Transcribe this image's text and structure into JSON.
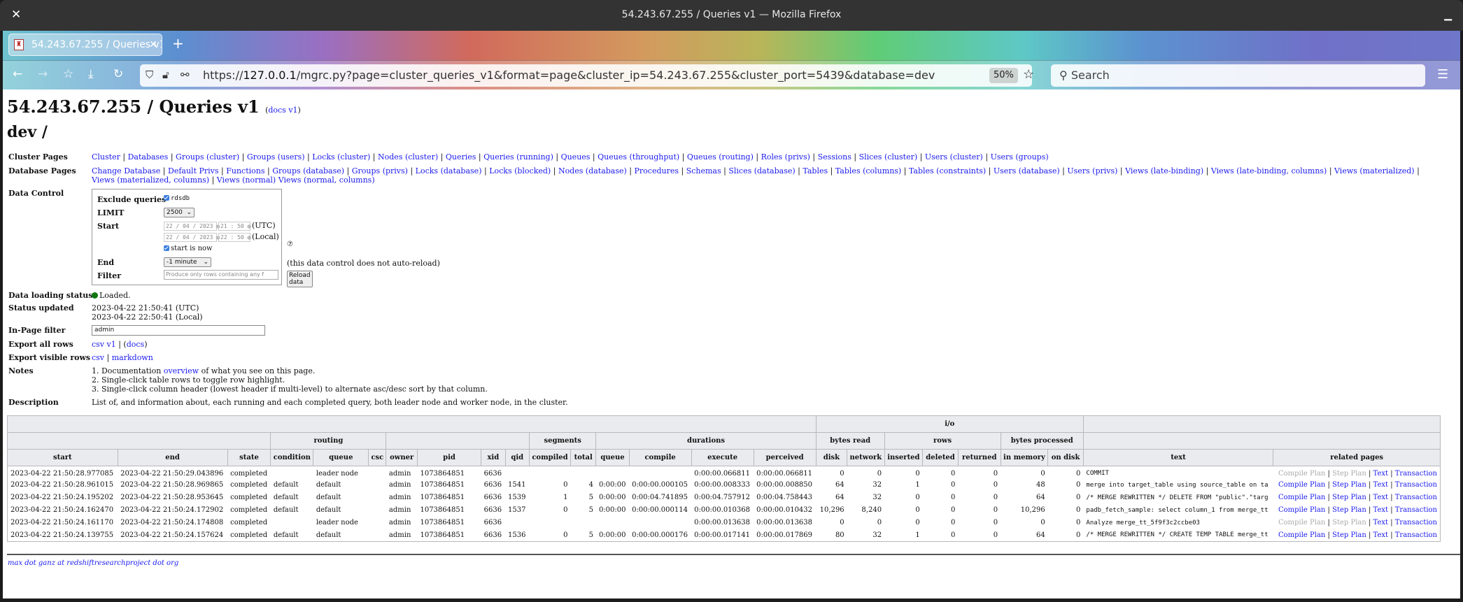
{
  "window": {
    "title": "54.243.67.255 / Queries v1 — Mozilla Firefox",
    "close_icon": "close-icon",
    "minimize_icon": "minimize-icon"
  },
  "browser": {
    "tab_title": "54.243.67.255 / Queries v1",
    "url_prefix": "https://",
    "url_host": "127.0.0.1",
    "url_rest": "/mgrc.py?page=cluster_queries_v1&format=page&cluster_ip=54.243.67.255&cluster_port=5439&database=dev",
    "zoom": "50%",
    "search_placeholder": "Search"
  },
  "page": {
    "title": "54.243.67.255 / Queries v1",
    "docs_link": "docs v1",
    "subtitle": "dev /",
    "cluster_pages_label": "Cluster Pages",
    "cluster_pages": [
      "Cluster",
      "Databases",
      "Groups (cluster)",
      "Groups (users)",
      "Locks (cluster)",
      "Nodes (cluster)",
      "Queries",
      "Queries (running)",
      "Queues",
      "Queues (throughput)",
      "Queues (routing)",
      "Roles (privs)",
      "Sessions",
      "Slices (cluster)",
      "Users (cluster)",
      "Users (groups)"
    ],
    "database_pages_label": "Database Pages",
    "database_pages": [
      "Change Database",
      "Default Privs",
      "Functions",
      "Groups (database)",
      "Groups (privs)",
      "Locks (database)",
      "Locks (blocked)",
      "Nodes (database)",
      "Procedures",
      "Schemas",
      "Slices (database)",
      "Tables",
      "Tables (columns)",
      "Tables (constraints)",
      "Users (database)",
      "Users (privs)",
      "Views (late-binding)",
      "Views (late-binding, columns)",
      "Views (materialized)",
      "Views (materialized, columns)",
      "Views (normal)",
      "Views (normal, columns)"
    ],
    "data_control": {
      "label": "Data Control",
      "exclude_label": "Exclude queries",
      "exclude_value": "rdsdb",
      "exclude_checked": true,
      "limit_label": "LIMIT",
      "limit_value": "2500",
      "start_label": "Start",
      "start_utc_date": "22 / 04 / 2023",
      "start_utc_time": "21 : 50",
      "utc_suffix": "(UTC)",
      "start_local_date": "22 / 04 / 2023",
      "start_local_time": "22 : 50",
      "local_suffix": "(Local)",
      "start_is_now_label": "start is now",
      "start_is_now_checked": true,
      "end_label": "End",
      "end_value": "-1 minute",
      "filter_label": "Filter",
      "filter_placeholder": "Produce only rows containing any f",
      "help_icon": "?",
      "no_reload_note": "(this data control does not auto-reload)",
      "reload_button": "Reload data"
    },
    "loading_status_label": "Data loading status",
    "loading_status": "Loaded.",
    "status_color": "#117711",
    "status_updated_label": "Status updated",
    "status_updated_utc": "2023-04-22 21:50:41 (UTC)",
    "status_updated_local": "2023-04-22 22:50:41 (Local)",
    "inpage_filter_label": "In-Page filter",
    "inpage_filter_value": "admin",
    "export_all_label": "Export all rows",
    "export_all_csv": "csv v1",
    "export_all_docs": "docs",
    "export_visible_label": "Export visible rows",
    "export_visible_csv": "csv",
    "export_visible_markdown": "markdown",
    "notes_label": "Notes",
    "notes_1_pre": "1. Documentation ",
    "notes_1_link": "overview",
    "notes_1_post": " of what you see on this page.",
    "notes_2": "2. Single-click table rows to toggle row highlight.",
    "notes_3": "3. Single-click column header (lowest header if multi-level) to alternate asc/desc sort by that column.",
    "description_label": "Description",
    "description": "List of, and information about, each running and each completed query, both leader node and worker node, in the cluster.",
    "footer": "max dot ganz at redshiftresearchproject dot org"
  },
  "table": {
    "group_top": {
      "io": "i/o"
    },
    "group_mid": {
      "routing": "routing",
      "segments": "segments",
      "durations": "durations",
      "bytes_read": "bytes read",
      "rows": "rows",
      "bytes_processed": "bytes processed"
    },
    "columns": [
      "start",
      "end",
      "state",
      "condition",
      "queue",
      "csc",
      "owner",
      "pid",
      "xid",
      "qid",
      "compiled",
      "total",
      "queue",
      "compile",
      "execute",
      "perceived",
      "disk",
      "network",
      "inserted",
      "deleted",
      "returned",
      "in memory",
      "on disk",
      "text",
      "related pages"
    ],
    "related_labels": {
      "compile_plan": "Compile Plan",
      "step_plan": "Step Plan",
      "text": "Text",
      "transaction": "Transaction"
    },
    "rows": [
      {
        "start": "2023-04-22 21:50:28.977085",
        "end": "2023-04-22 21:50:29.043896",
        "state": "completed",
        "condition": "",
        "queue": "leader node",
        "csc": "",
        "owner": "admin",
        "pid": "1073864851",
        "xid": "6636",
        "qid": "",
        "compiled": "",
        "total": "",
        "dqueue": "",
        "compile": "",
        "execute": "0:00:00.066811",
        "perceived": "0:00:00.066811",
        "disk": "0",
        "network": "0",
        "inserted": "0",
        "deleted": "0",
        "returned": "0",
        "in_memory": "0",
        "on_disk": "0",
        "text": "COMMIT",
        "plans_enabled": false
      },
      {
        "start": "2023-04-22 21:50:28.961015",
        "end": "2023-04-22 21:50:28.969865",
        "state": "completed",
        "condition": "default",
        "queue": "default",
        "csc": "",
        "owner": "admin",
        "pid": "1073864851",
        "xid": "6636",
        "qid": "1541",
        "compiled": "0",
        "total": "4",
        "dqueue": "0:00:00",
        "compile": "0:00:00.000105",
        "execute": "0:00:00.008333",
        "perceived": "0:00:00.008850",
        "disk": "64",
        "network": "32",
        "inserted": "1",
        "deleted": "0",
        "returned": "0",
        "in_memory": "48",
        "on_disk": "0",
        "text": "merge into target_table using source_table on ta",
        "plans_enabled": true
      },
      {
        "start": "2023-04-22 21:50:24.195202",
        "end": "2023-04-22 21:50:28.953645",
        "state": "completed",
        "condition": "default",
        "queue": "default",
        "csc": "",
        "owner": "admin",
        "pid": "1073864851",
        "xid": "6636",
        "qid": "1539",
        "compiled": "1",
        "total": "5",
        "dqueue": "0:00:00",
        "compile": "0:00:04.741895",
        "execute": "0:00:04.757912",
        "perceived": "0:00:04.758443",
        "disk": "64",
        "network": "32",
        "inserted": "0",
        "deleted": "0",
        "returned": "0",
        "in_memory": "64",
        "on_disk": "0",
        "text": "/* MERGE REWRITTEN */ DELETE FROM \"public\".\"targ",
        "plans_enabled": true
      },
      {
        "start": "2023-04-22 21:50:24.162470",
        "end": "2023-04-22 21:50:24.172902",
        "state": "completed",
        "condition": "default",
        "queue": "default",
        "csc": "",
        "owner": "admin",
        "pid": "1073864851",
        "xid": "6636",
        "qid": "1537",
        "compiled": "0",
        "total": "5",
        "dqueue": "0:00:00",
        "compile": "0:00:00.000114",
        "execute": "0:00:00.010368",
        "perceived": "0:00:00.010432",
        "disk": "10,296",
        "network": "8,240",
        "inserted": "0",
        "deleted": "0",
        "returned": "0",
        "in_memory": "10,296",
        "on_disk": "0",
        "text": "padb_fetch_sample: select column_1 from merge_tt",
        "plans_enabled": true
      },
      {
        "start": "2023-04-22 21:50:24.161170",
        "end": "2023-04-22 21:50:24.174808",
        "state": "completed",
        "condition": "",
        "queue": "leader node",
        "csc": "",
        "owner": "admin",
        "pid": "1073864851",
        "xid": "6636",
        "qid": "",
        "compiled": "",
        "total": "",
        "dqueue": "",
        "compile": "",
        "execute": "0:00:00.013638",
        "perceived": "0:00:00.013638",
        "disk": "0",
        "network": "0",
        "inserted": "0",
        "deleted": "0",
        "returned": "0",
        "in_memory": "0",
        "on_disk": "0",
        "text": "Analyze merge_tt_5f9f3c2ccbe03",
        "plans_enabled": false
      },
      {
        "start": "2023-04-22 21:50:24.139755",
        "end": "2023-04-22 21:50:24.157624",
        "state": "completed",
        "condition": "default",
        "queue": "default",
        "csc": "",
        "owner": "admin",
        "pid": "1073864851",
        "xid": "6636",
        "qid": "1536",
        "compiled": "0",
        "total": "5",
        "dqueue": "0:00:00",
        "compile": "0:00:00.000176",
        "execute": "0:00:00.017141",
        "perceived": "0:00:00.017869",
        "disk": "80",
        "network": "32",
        "inserted": "1",
        "deleted": "0",
        "returned": "0",
        "in_memory": "64",
        "on_disk": "0",
        "text": "/* MERGE REWRITTEN */ CREATE TEMP TABLE merge_tt",
        "plans_enabled": true
      }
    ]
  }
}
